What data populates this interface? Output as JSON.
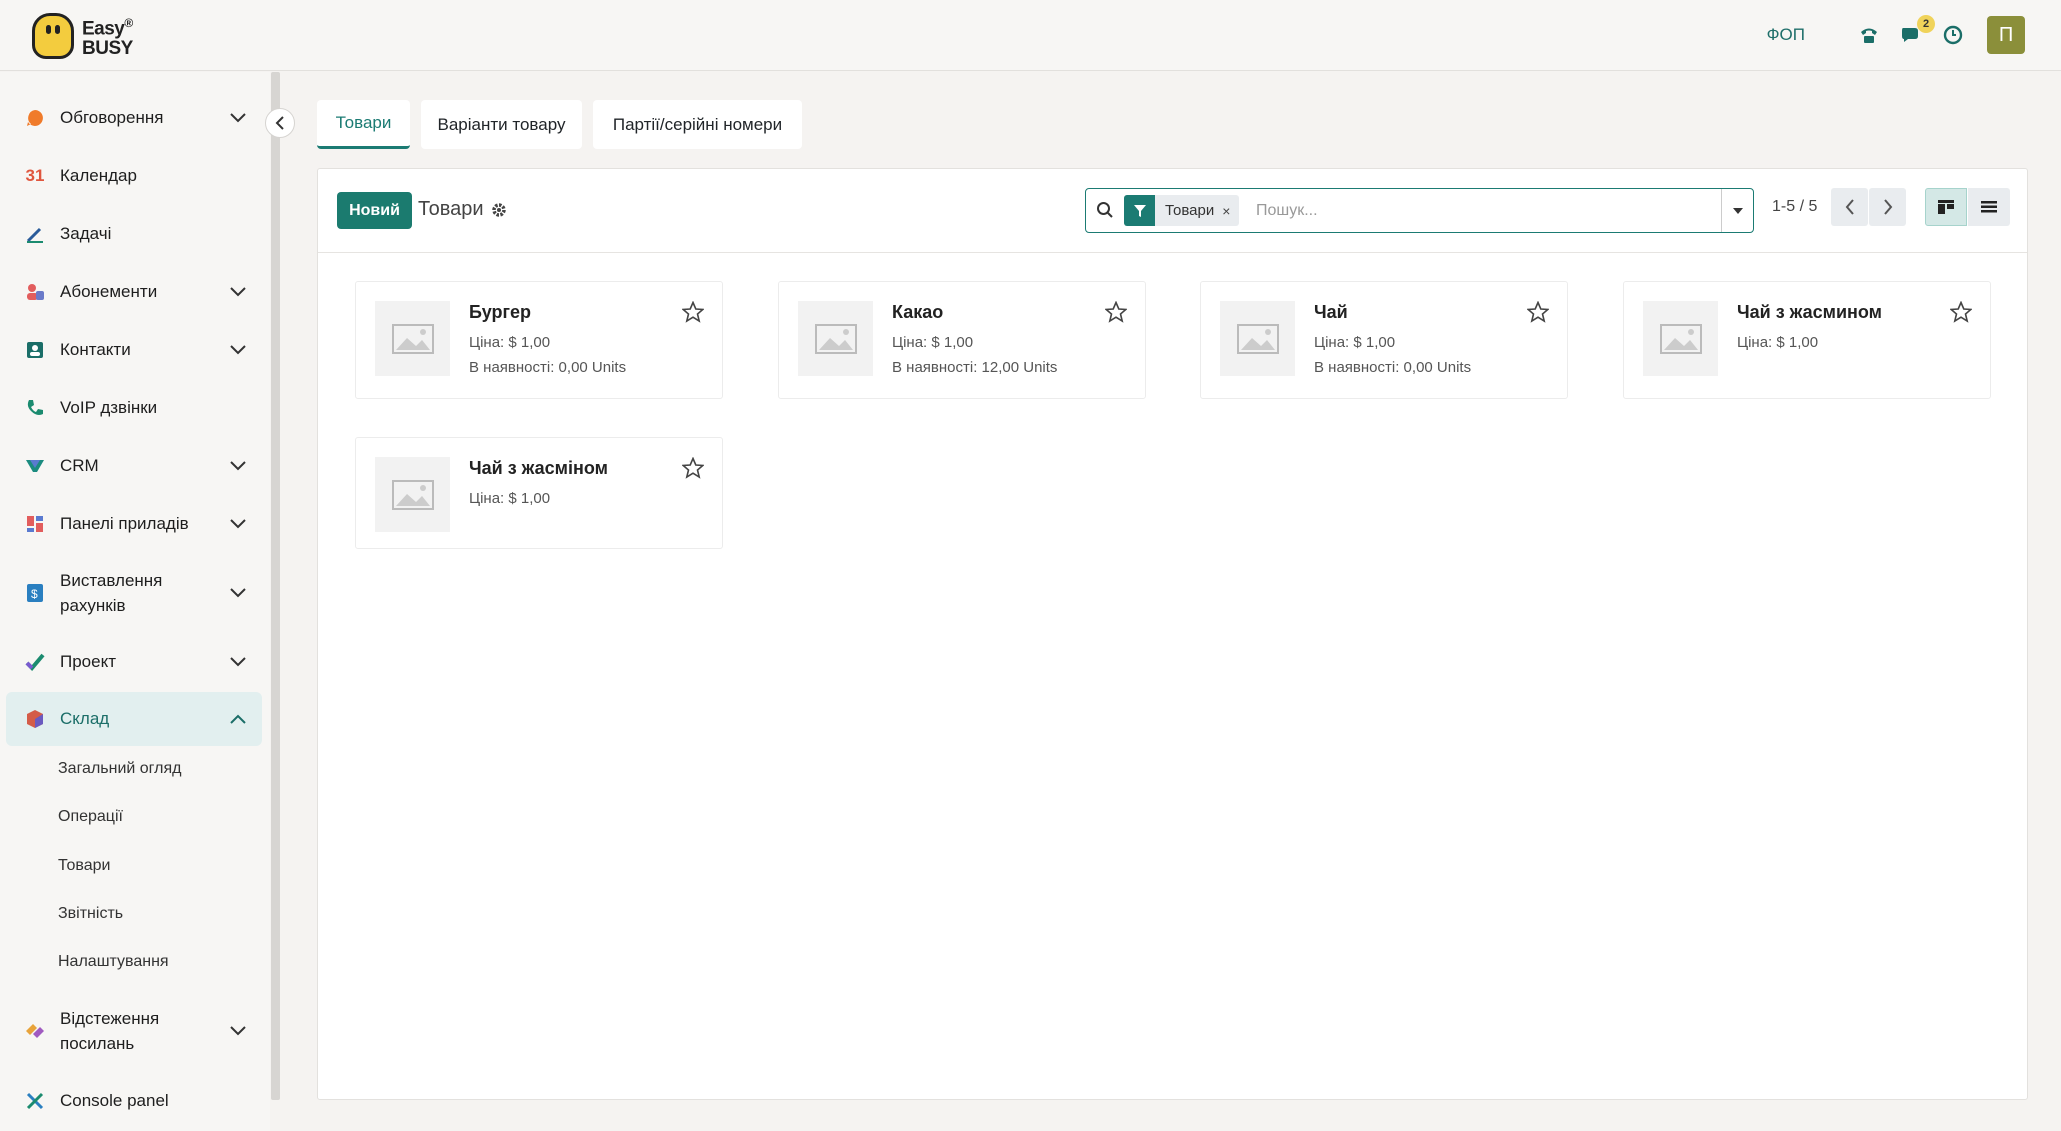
{
  "header": {
    "logo_text_top": "Easy",
    "logo_text_bottom": "BUSY",
    "company": "ФОП",
    "messages_badge": "2",
    "user_initial": "П"
  },
  "sidebar": {
    "items": [
      {
        "label": "Обговорення"
      },
      {
        "label": "Календар"
      },
      {
        "label": "Задачі"
      },
      {
        "label": "Абонементи"
      },
      {
        "label": "Контакти"
      },
      {
        "label": "VoIP дзвінки"
      },
      {
        "label": "CRM"
      },
      {
        "label": "Панелі приладів"
      },
      {
        "label": "Виставлення",
        "label2": "рахунків"
      },
      {
        "label": "Проект"
      },
      {
        "label": "Склад"
      },
      {
        "label": "Відстеження",
        "label2": "посилань"
      },
      {
        "label": "Console panel"
      }
    ],
    "calendar_icon_text": "31",
    "subitems": [
      "Загальний огляд",
      "Операції",
      "Товари",
      "Звітність",
      "Налаштування"
    ]
  },
  "tabs": [
    "Товари",
    "Варіанти товару",
    "Партії/серійні номери"
  ],
  "control_panel": {
    "new_button": "Новий",
    "title": "Товари",
    "search_facet": "Товари",
    "search_placeholder": "Пошук...",
    "pager": "1-5 / 5"
  },
  "products": [
    {
      "name": "Бургер",
      "price": "Ціна: $ 1,00",
      "stock": "В наявності: 0,00 Units"
    },
    {
      "name": "Какао",
      "price": "Ціна: $ 1,00",
      "stock": "В наявності: 12,00 Units"
    },
    {
      "name": "Чай",
      "price": "Ціна: $ 1,00",
      "stock": "В наявності: 0,00 Units"
    },
    {
      "name": "Чай з жасмином",
      "price": "Ціна: $ 1,00"
    },
    {
      "name": "Чай з жасміном",
      "price": "Ціна: $ 1,00"
    }
  ],
  "colors": {
    "accent": "#1b7b73",
    "active_bg": "#e2efef"
  }
}
